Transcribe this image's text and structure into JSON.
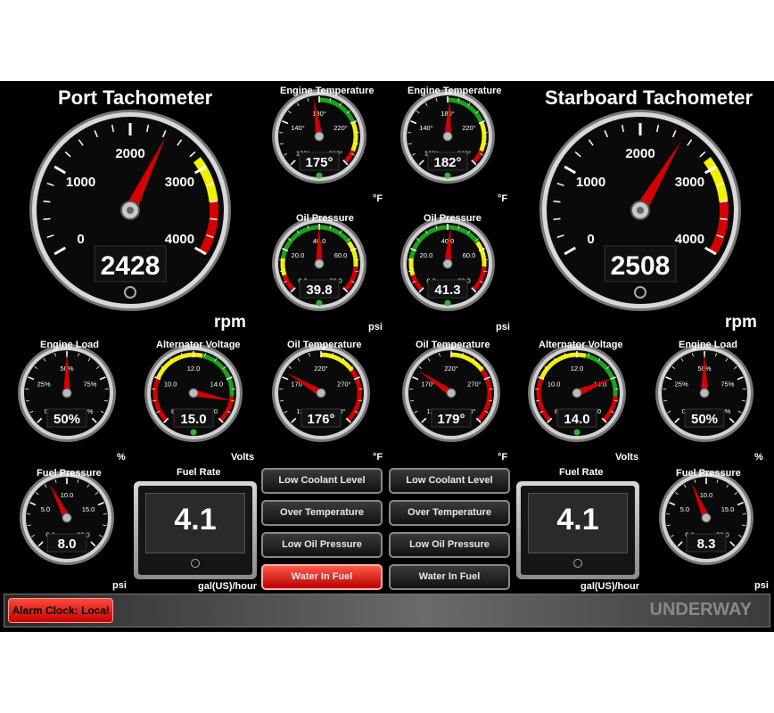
{
  "colors": {
    "needle": "#d40000",
    "green": "#19a319",
    "yellow": "#f2f200",
    "red": "#d40000",
    "background": "#000000"
  },
  "tachs": [
    {
      "key": "port",
      "title": "Port Tachometer",
      "unit": "rpm",
      "readout": "2428",
      "value": 2428,
      "labels": [
        "0",
        "1000",
        "2000",
        "3000",
        "4000"
      ],
      "min": 0,
      "max": 4000
    },
    {
      "key": "starboard",
      "title": "Starboard Tachometer",
      "unit": "rpm",
      "readout": "2508",
      "value": 2508,
      "labels": [
        "0",
        "1000",
        "2000",
        "3000",
        "4000"
      ],
      "min": 0,
      "max": 4000
    }
  ],
  "gauges": [
    {
      "id": "eng-temp-port",
      "title": "Engine Temperature",
      "unit": "°F",
      "readout": "175°",
      "value": 175,
      "min": 100,
      "max": 260,
      "labels": [
        "100°",
        "140°",
        "180°",
        "220°",
        "260°"
      ],
      "has_led": true
    },
    {
      "id": "eng-temp-stbd",
      "title": "Engine Temperature",
      "unit": "°F",
      "readout": "182°",
      "value": 182,
      "min": 100,
      "max": 260,
      "labels": [
        "100°",
        "140°",
        "180°",
        "220°",
        "260°"
      ],
      "has_led": true
    },
    {
      "id": "oil-press-port",
      "title": "Oil Pressure",
      "unit": "psi",
      "readout": "39.8",
      "value": 39.8,
      "min": 0,
      "max": 80,
      "labels": [
        "0.0",
        "20.0",
        "40.0",
        "60.0",
        "80.0"
      ],
      "has_led": true
    },
    {
      "id": "oil-press-stbd",
      "title": "Oil Pressure",
      "unit": "psi",
      "readout": "41.3",
      "value": 41.3,
      "min": 0,
      "max": 80,
      "labels": [
        "0.0",
        "20.0",
        "40.0",
        "60.0",
        "80.0"
      ],
      "has_led": true
    },
    {
      "id": "eng-load-port",
      "title": "Engine Load",
      "unit": "%",
      "readout": "50%",
      "value": 50,
      "min": 0,
      "max": 100,
      "labels": [
        "0%",
        "25%",
        "50%",
        "75%",
        "100%"
      ],
      "has_led": false
    },
    {
      "id": "alt-volt-port",
      "title": "Alternator Voltage",
      "unit": "Volts",
      "readout": "15.0",
      "value": 15.0,
      "min": 8,
      "max": 16,
      "labels": [
        "8.0",
        "10.0",
        "12.0",
        "14.0",
        "16.0"
      ],
      "has_led": true
    },
    {
      "id": "oil-temp-port",
      "title": "Oil Temperature",
      "unit": "°F",
      "readout": "176°",
      "value": 176,
      "min": 120,
      "max": 320,
      "labels": [
        "120°",
        "170°",
        "220°",
        "270°",
        "320°"
      ],
      "has_led": false
    },
    {
      "id": "oil-temp-stbd",
      "title": "Oil Temperature",
      "unit": "°F",
      "readout": "179°",
      "value": 179,
      "min": 120,
      "max": 320,
      "labels": [
        "120°",
        "170°",
        "220°",
        "270°",
        "320°"
      ],
      "has_led": false
    },
    {
      "id": "alt-volt-stbd",
      "title": "Alternator Voltage",
      "unit": "Volts",
      "readout": "14.0",
      "value": 14.0,
      "min": 8,
      "max": 16,
      "labels": [
        "8.0",
        "10.0",
        "12.0",
        "14.0",
        "16.0"
      ],
      "has_led": true
    },
    {
      "id": "eng-load-stbd",
      "title": "Engine Load",
      "unit": "%",
      "readout": "50%",
      "value": 50,
      "min": 0,
      "max": 100,
      "labels": [
        "0%",
        "25%",
        "50%",
        "75%",
        "100%"
      ],
      "has_led": false
    },
    {
      "id": "fuel-press-port",
      "title": "Fuel Pressure",
      "unit": "psi",
      "readout": "8.0",
      "value": 8.0,
      "min": 0,
      "max": 20,
      "labels": [
        "0.0",
        "5.0",
        "10.0",
        "15.0",
        "20.0"
      ],
      "has_led": false
    },
    {
      "id": "fuel-press-stbd",
      "title": "Fuel Pressure",
      "unit": "psi",
      "readout": "8.3",
      "value": 8.3,
      "min": 0,
      "max": 20,
      "labels": [
        "0.0",
        "5.0",
        "10.0",
        "15.0",
        "20.0"
      ],
      "has_led": false
    }
  ],
  "fuel_rate": [
    {
      "title": "Fuel Rate",
      "value": "4.1",
      "unit": "gal(US)/hour"
    },
    {
      "title": "Fuel Rate",
      "value": "4.1",
      "unit": "gal(US)/hour"
    }
  ],
  "alarms": {
    "port": [
      {
        "label": "Low Coolant Level",
        "active": false
      },
      {
        "label": "Over Temperature",
        "active": false
      },
      {
        "label": "Low Oil Pressure",
        "active": false
      },
      {
        "label": "Water In Fuel",
        "active": true
      }
    ],
    "starboard": [
      {
        "label": "Low Coolant Level",
        "active": false
      },
      {
        "label": "Over Temperature",
        "active": false
      },
      {
        "label": "Low Oil Pressure",
        "active": false
      },
      {
        "label": "Water In Fuel",
        "active": false
      }
    ]
  },
  "status": {
    "alarm_clock": "Alarm Clock: Local",
    "mode": "UNDERWAY"
  }
}
